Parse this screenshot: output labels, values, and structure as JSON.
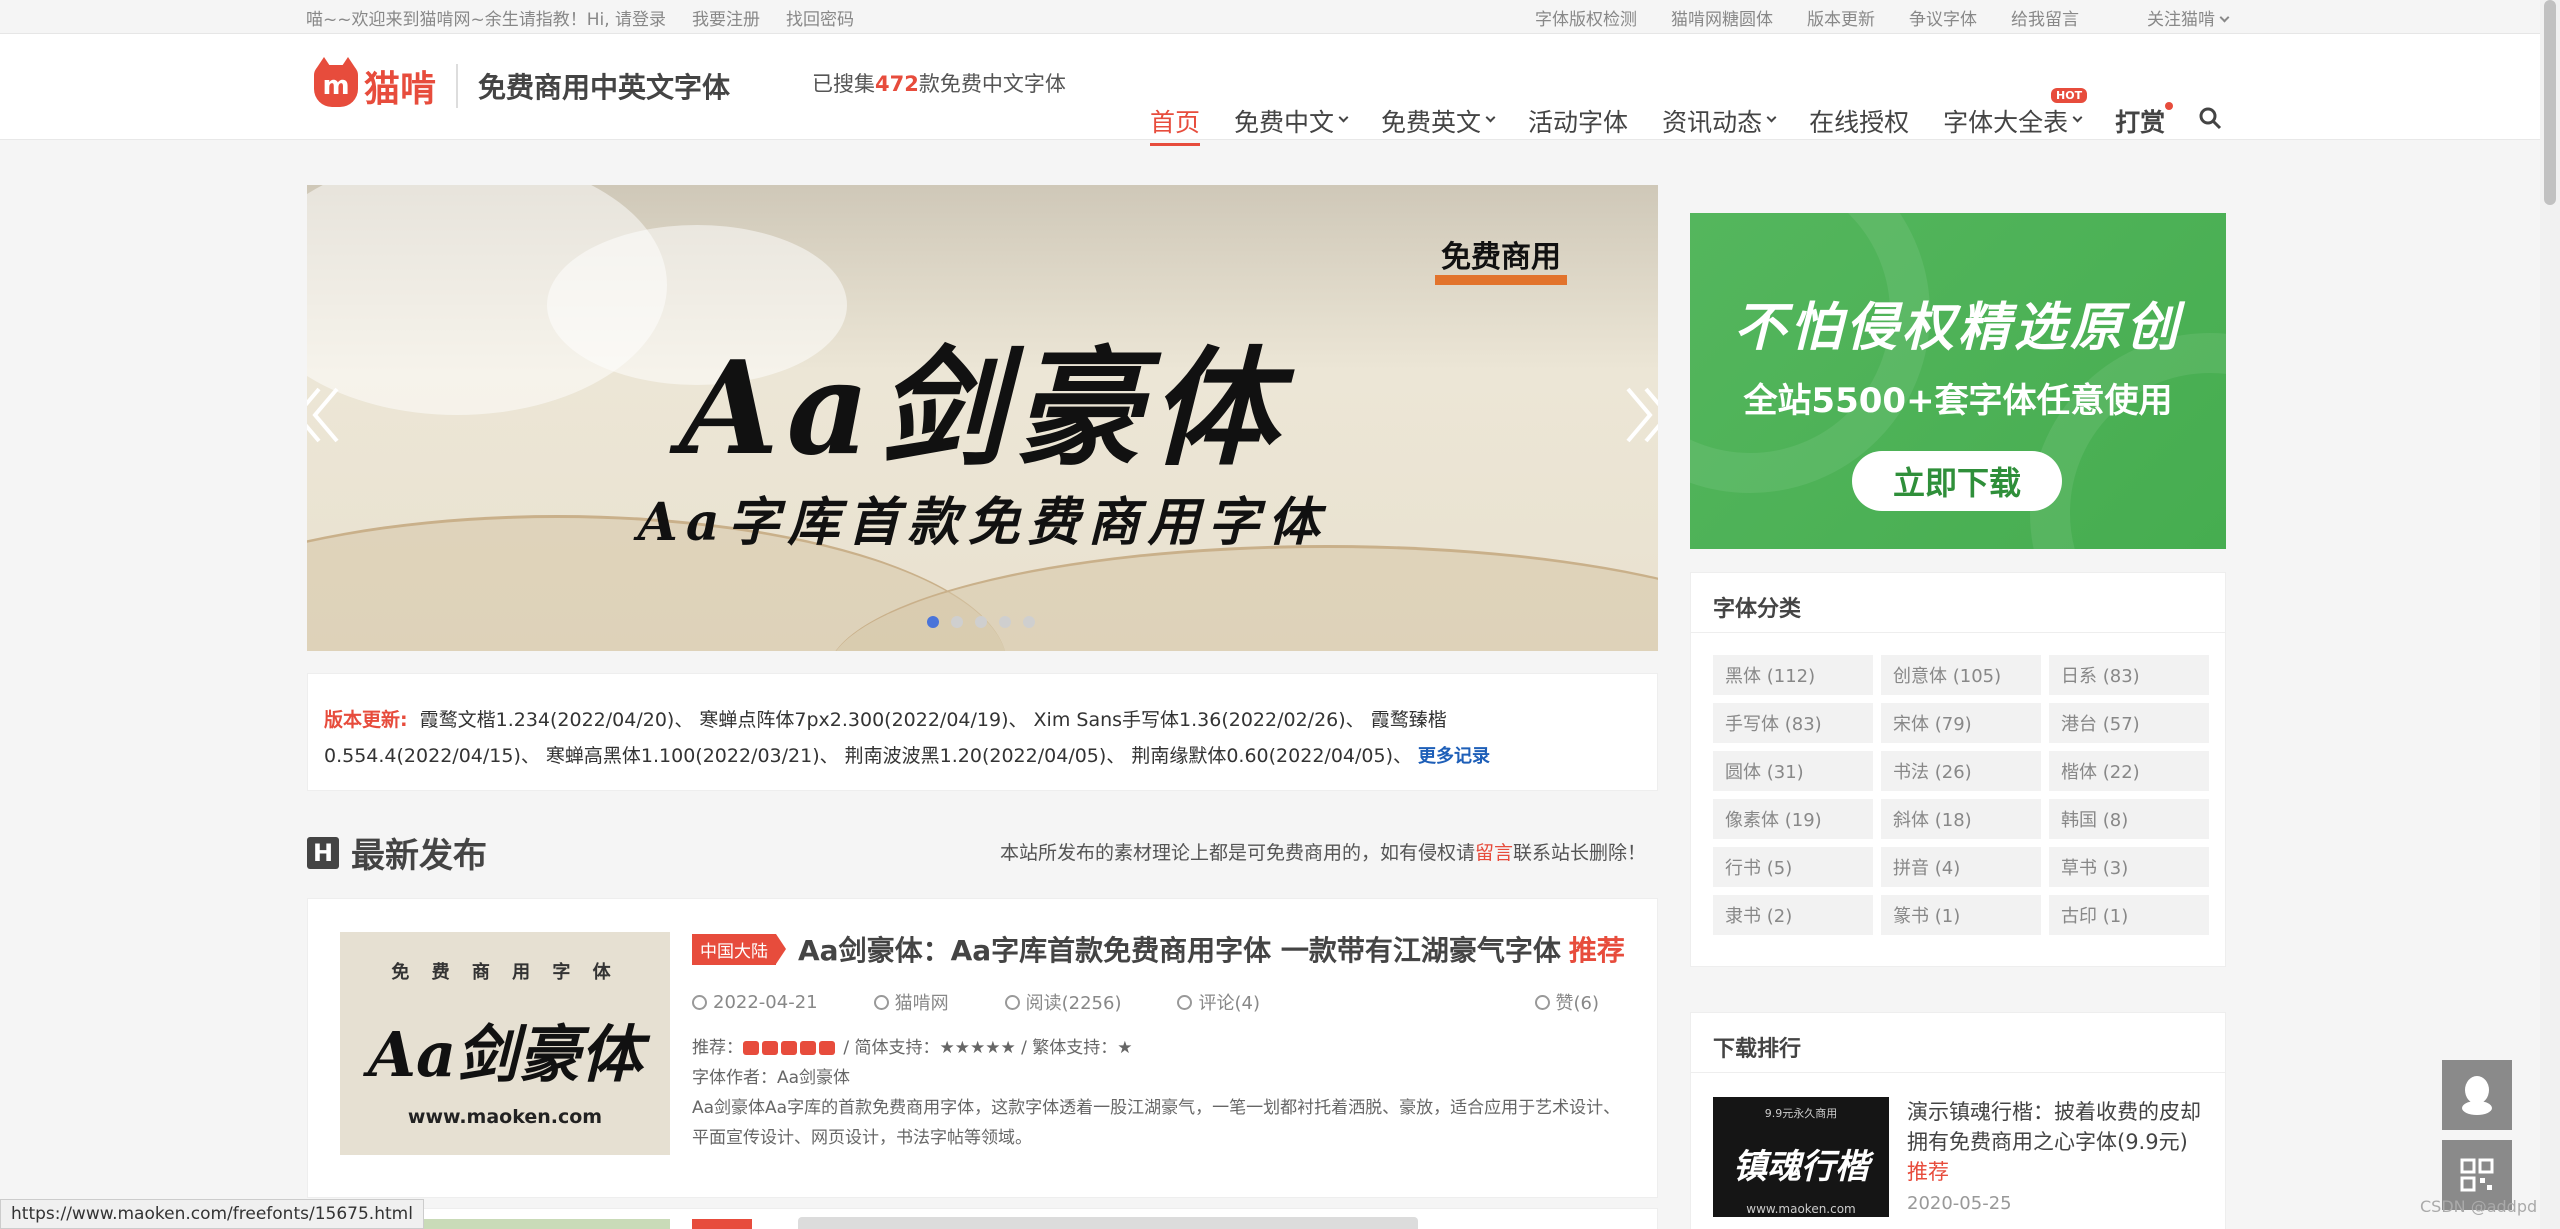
{
  "topbar": {
    "welcome": "喵~~欢迎来到猫啃网~余生请指教！Hi, 请登录",
    "register": "我要注册",
    "recover": "找回密码",
    "right_links": [
      "字体版权检测",
      "猫啃网糖圆体",
      "版本更新",
      "争议字体",
      "给我留言",
      "关注猫啃"
    ]
  },
  "header": {
    "brand": "猫啃",
    "slogan": "免费商用中英文字体",
    "count_prefix": "已搜集",
    "count": "472",
    "count_suffix": "款免费中文字体",
    "nav": [
      "首页",
      "免费中文",
      "免费英文",
      "活动字体",
      "资讯动态",
      "在线授权",
      "字体大全表",
      "打赏"
    ],
    "hot_badge": "HOT"
  },
  "banner": {
    "tag": "免费商用",
    "title": "Aa剑豪体",
    "subtitle": "Aa字库首款免费商用字体",
    "slide_count": 5,
    "active_slide": 0
  },
  "updates": {
    "label": "版本更新:",
    "items": "霞鹜文楷1.234(2022/04/20)、 寒蝉点阵体7px2.300(2022/04/19)、 Xim Sans手写体1.36(2022/02/26)、 霞鹜臻楷0.554.4(2022/04/15)、 寒蝉高黑体1.100(2022/03/21)、 荆南波波黑1.20(2022/04/05)、 荆南缘默体0.60(2022/04/05)、",
    "more": "更多记录"
  },
  "latest": {
    "icon_letter": "H",
    "title": "最新发布",
    "disclaimer_a": "本站所发布的素材理论上都是可免费商用的，如有侵权请",
    "disclaimer_link": "留言",
    "disclaimer_b": "联系站长删除！"
  },
  "article": {
    "thumb_top": "免 费 商 用 字 体",
    "thumb_title": "Aa剑豪体",
    "thumb_url": "www.maoken.com",
    "region": "中国大陆",
    "title": "Aa剑豪体：Aa字库首款免费商用字体 一款带有江湖豪气字体",
    "recommend": "推荐",
    "date": "2022-04-21",
    "author": "猫啃网",
    "views": "阅读(2256)",
    "comments": "评论(4)",
    "likes": "赞(6)",
    "support_label": "推荐：",
    "support_text": "/ 简体支持：★★★★★ / 繁体支持：★",
    "font_author": "字体作者：Aa剑豪体",
    "desc": "Aa剑豪体Aa字库的首款免费商用字体，这款字体透着一股江湖豪气，一笔一划都衬托着洒脱、豪放，适合应用于艺术设计、平面宣传设计、网页设计，书法字帖等领域。"
  },
  "side_ad": {
    "line1": "不怕侵权精选原创",
    "line2": "全站5500+套字体任意使用",
    "button": "立即下载"
  },
  "categories": {
    "title": "字体分类",
    "items": [
      "黑体 (112)",
      "创意体 (105)",
      "日系 (83)",
      "手写体 (83)",
      "宋体 (79)",
      "港台 (57)",
      "圆体 (31)",
      "书法 (26)",
      "楷体 (22)",
      "像素体 (19)",
      "斜体 (18)",
      "韩国 (8)",
      "行书 (5)",
      "拼音 (4)",
      "草书 (3)",
      "隶书 (2)",
      "篆书 (1)",
      "古印 (1)"
    ]
  },
  "ranking": {
    "title": "下载排行",
    "thumb_top": "9.9元永久商用",
    "thumb_title": "镇魂行楷",
    "thumb_url": "www.maoken.com",
    "item_title": "演示镇魂行楷：披着收费的皮却拥有免费商用之心字体(9.9元)",
    "recommend": "推荐",
    "date": "2020-05-25"
  },
  "status_url": "https://www.maoken.com/freefonts/15675.html",
  "watermark": "CSDN @addpd",
  "colors": {
    "accent": "#e74c3c",
    "ad_green": "#4caf50",
    "link_blue": "#1e5fb8"
  }
}
